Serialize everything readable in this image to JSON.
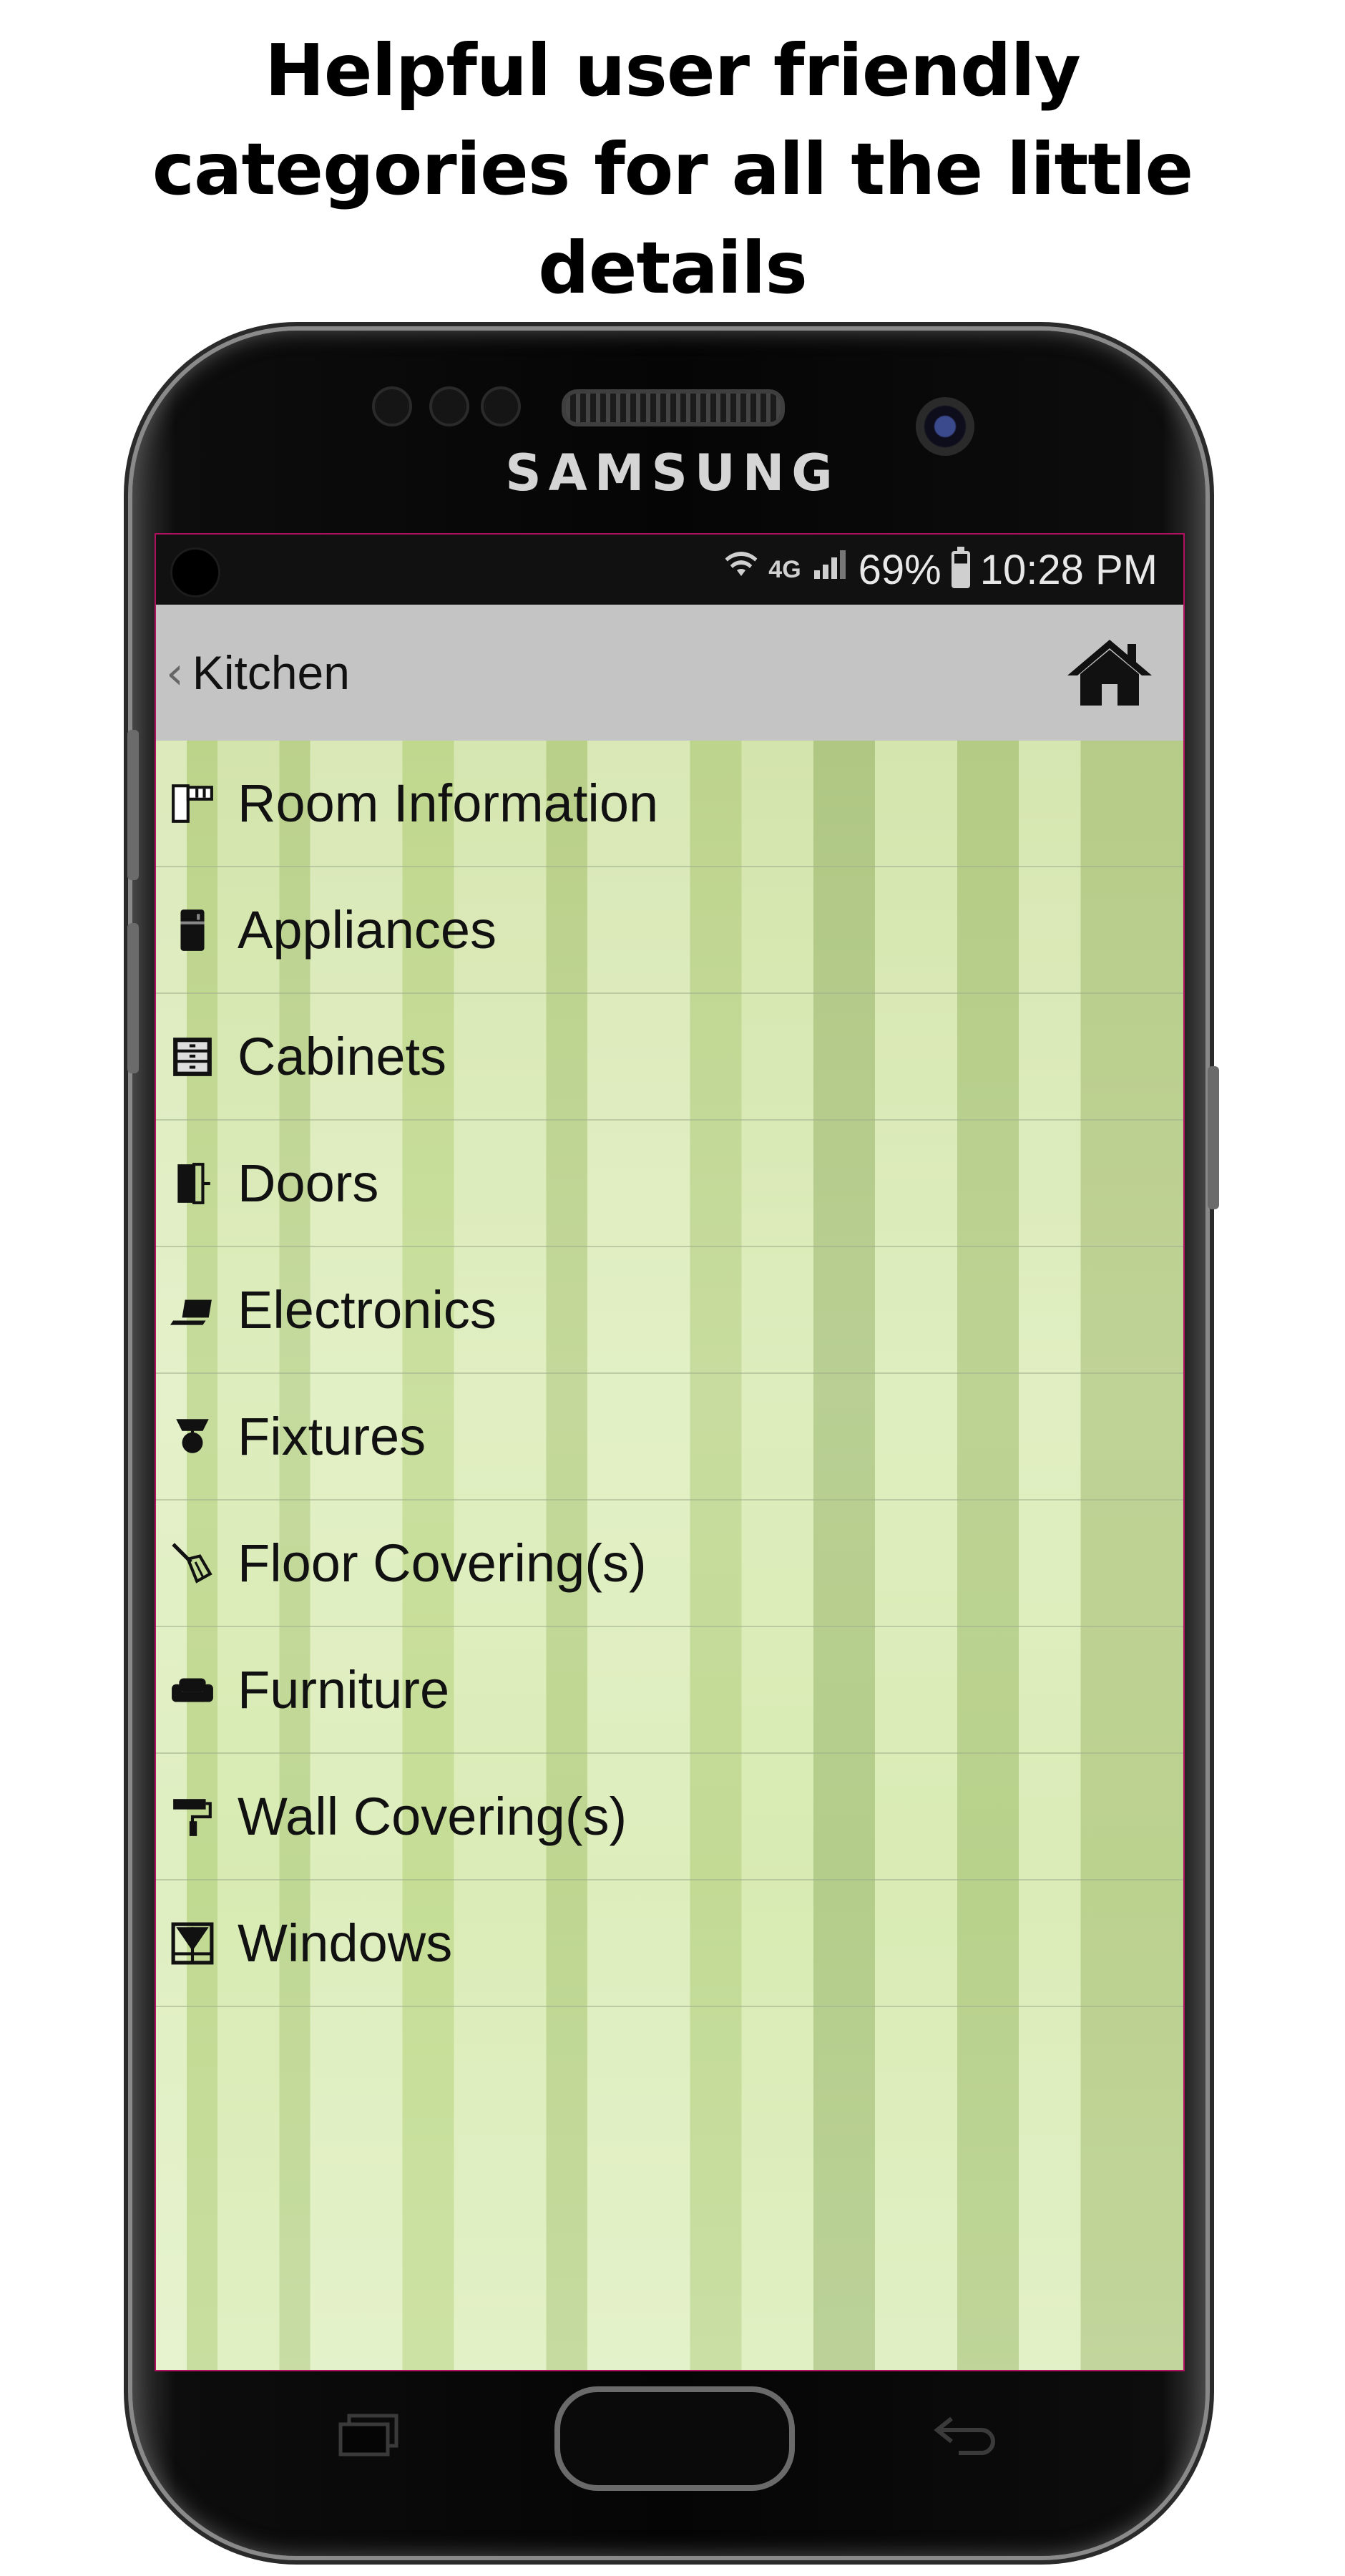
{
  "headline": {
    "line1": "Helpful user friendly",
    "line2": "categories for all the little",
    "line3": "details"
  },
  "device": {
    "brand": "SAMSUNG"
  },
  "status_bar": {
    "network": "4G",
    "battery": "69%",
    "time": "10:28 PM",
    "battery_level": 0.69
  },
  "nav_bar": {
    "back_label": "Kitchen",
    "back_icon": "chevron-left-icon",
    "home_icon": "home-icon"
  },
  "categories": [
    {
      "label": "Room Information",
      "icon": "room-information-icon"
    },
    {
      "label": "Appliances",
      "icon": "refrigerator-icon"
    },
    {
      "label": "Cabinets",
      "icon": "cabinet-icon"
    },
    {
      "label": "Doors",
      "icon": "door-icon"
    },
    {
      "label": "Electronics",
      "icon": "laptop-icon"
    },
    {
      "label": "Fixtures",
      "icon": "lamp-icon"
    },
    {
      "label": "Floor Covering(s)",
      "icon": "broom-icon"
    },
    {
      "label": "Furniture",
      "icon": "sofa-icon"
    },
    {
      "label": "Wall Covering(s)",
      "icon": "paint-roller-icon"
    },
    {
      "label": "Windows",
      "icon": "window-icon"
    }
  ],
  "colors": {
    "nav_bar_bg": "#c4c4c4",
    "content_bg": "#d6e9ad",
    "status_bar_bg": "#111111",
    "screen_border": "#b01060"
  }
}
